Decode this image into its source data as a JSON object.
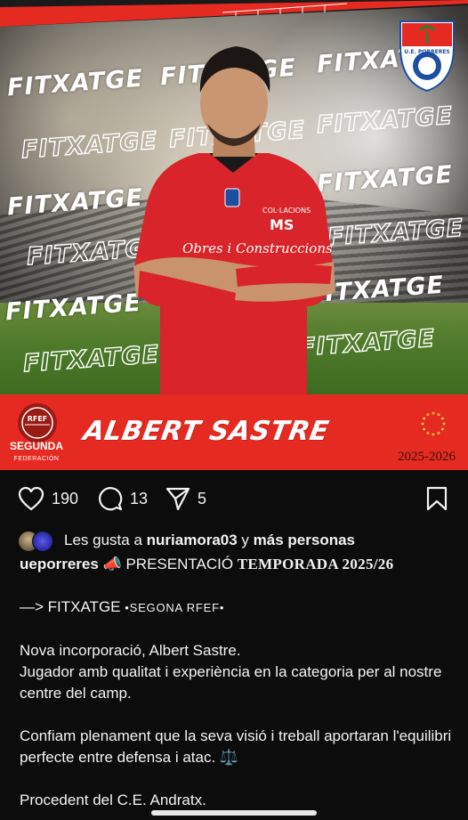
{
  "post": {
    "watermark_word": "FITXATGE",
    "club_badge_text": "U.E. PORRERES",
    "player_name": "ALBERT SASTRE",
    "season": "2025-2026",
    "league_logo": {
      "line1": "RFEF",
      "line2": "SEGUNDA",
      "line3": "FEDERACIÓN"
    },
    "shirt_sponsor": "Obres i Construccions",
    "shirt_sponsor2": "COL·LACIONS",
    "shirt_sponsor3": "MS",
    "colors": {
      "band": "#e52a22",
      "shirt": "#d8242a",
      "background": "#0c0c0c"
    }
  },
  "actions": {
    "likes": "190",
    "comments": "13",
    "shares": "5"
  },
  "likes_line": {
    "prefix": "Les gusta a",
    "user": "nuriamora03",
    "connector": "y",
    "others": "más personas"
  },
  "caption": {
    "username": "ueporreres",
    "emoji": "📣",
    "headline": "PRESENTACIÓ",
    "headline_serif": "TEMPORADA 2025/26",
    "line2_prefix": "—> FITXATGE",
    "line2_suffix": "•SEGONA RFEF•",
    "p1": "Nova incorporació, Albert Sastre.",
    "p2": "Jugador amb qualitat i experiència en la categoria per al nostre centre del camp.",
    "p3": "Confiam plenament que la seva visió i treball aportaran l'equilibri perfecte entre defensa i atac. ⚖️",
    "p4": "Procedent del C.E. Andratx."
  }
}
